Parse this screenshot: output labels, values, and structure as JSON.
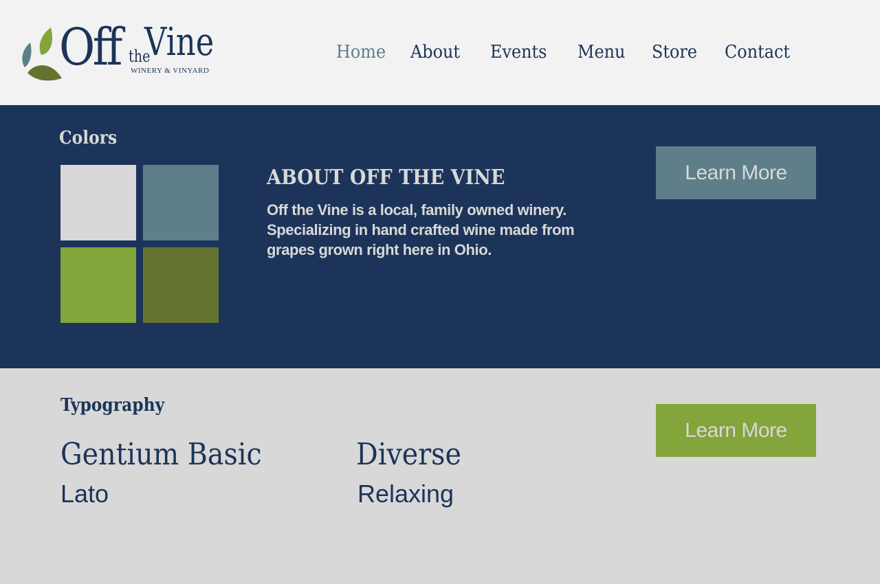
{
  "brand": {
    "name_off": "Off",
    "name_the": "the",
    "name_vine": "Vine",
    "tagline": "WINERY & VINYARD"
  },
  "nav": {
    "items": [
      {
        "label": "Home",
        "active": true
      },
      {
        "label": "About",
        "active": false
      },
      {
        "label": "Events",
        "active": false
      },
      {
        "label": "Menu",
        "active": false
      },
      {
        "label": "Store",
        "active": false
      },
      {
        "label": "Contact",
        "active": false
      }
    ]
  },
  "colors_section": {
    "heading": "Colors",
    "swatches": [
      "#d8d8d8",
      "#5e7f8a",
      "#84a43c",
      "#647430"
    ],
    "about_title": "ABOUT OFF THE VINE",
    "about_body": "Off the Vine is a local, family owned winery. Specializing in hand crafted wine made from grapes grown right here in Ohio.",
    "button_label": "Learn More"
  },
  "typography_section": {
    "heading": "Typography",
    "font_primary": "Gentium Basic",
    "font_secondary": "Lato",
    "word_primary": "Diverse",
    "word_secondary": "Relaxing",
    "button_label": "Learn More"
  },
  "theme": {
    "navy": "#1c3459",
    "light_gray": "#d8d8d8",
    "header_bg": "#f2f2f2",
    "slate": "#5e7f8a",
    "green": "#84a43c",
    "olive": "#647430"
  }
}
